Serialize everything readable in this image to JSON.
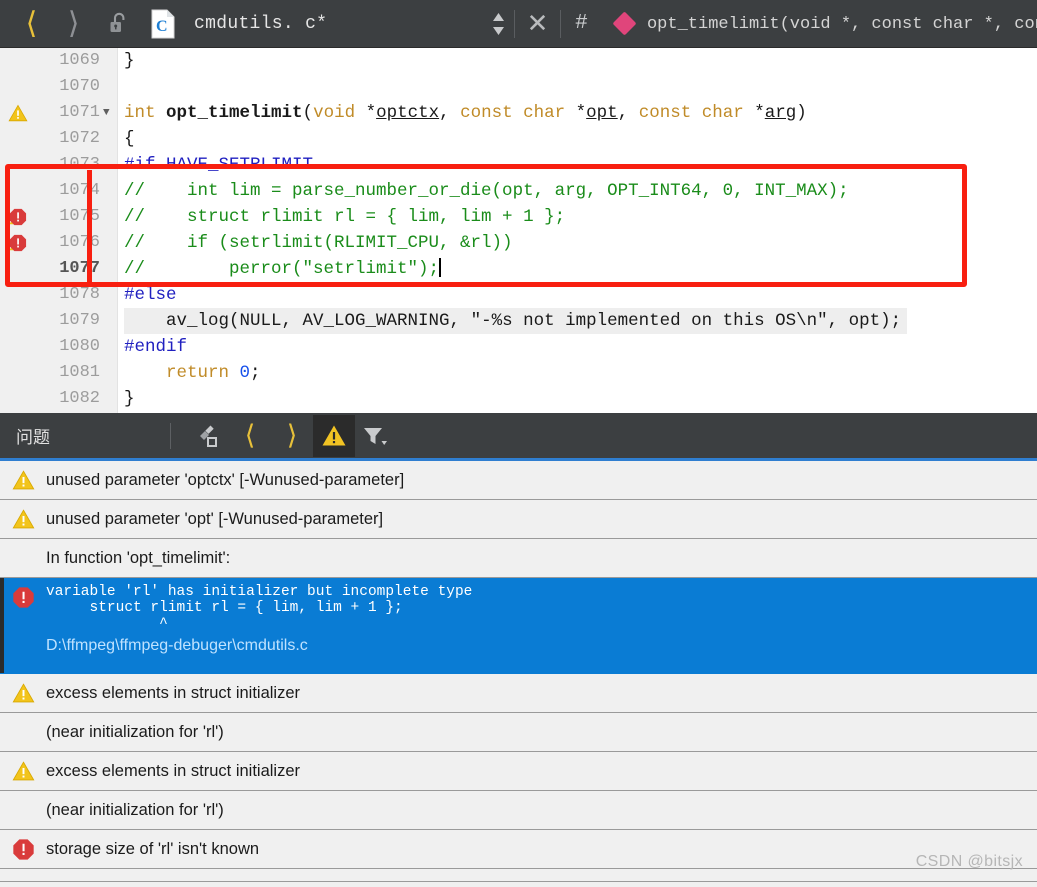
{
  "toolbar": {
    "back_icon": "chevron-left-icon",
    "forward_icon": "chevron-right-icon",
    "lock_icon": "unlock-icon",
    "file_type_icon": "c-file-icon",
    "file_type_letter": "C",
    "file_title": "cmdutils. c*",
    "updown_icon": "sort-updown-icon",
    "close_icon": "close-x-icon",
    "hash_label": "#",
    "member_icon": "pink-diamond-method-icon",
    "breadcrumb_signature": "opt_timelimit(void *, const char *, cons⋯"
  },
  "editor": {
    "first_line": 1069,
    "current_line": 1077,
    "lines": [
      {
        "num": "1069",
        "marker": "",
        "fold": false,
        "highlight": false,
        "tokens": [
          {
            "t": "}",
            "c": "s-plain"
          }
        ]
      },
      {
        "num": "1070",
        "marker": "",
        "fold": false,
        "highlight": false,
        "tokens": []
      },
      {
        "num": "1071",
        "marker": "warning",
        "fold": true,
        "highlight": false,
        "tokens": [
          {
            "t": "int ",
            "c": "s-kw"
          },
          {
            "t": "opt_timelimit",
            "c": "s-fn"
          },
          {
            "t": "(",
            "c": "s-plain"
          },
          {
            "t": "void ",
            "c": "s-kw"
          },
          {
            "t": "*",
            "c": "s-plain"
          },
          {
            "t": "optctx",
            "c": "s-param"
          },
          {
            "t": ", ",
            "c": "s-plain"
          },
          {
            "t": "const char ",
            "c": "s-kw"
          },
          {
            "t": "*",
            "c": "s-plain"
          },
          {
            "t": "opt",
            "c": "s-param"
          },
          {
            "t": ", ",
            "c": "s-plain"
          },
          {
            "t": "const char ",
            "c": "s-kw"
          },
          {
            "t": "*",
            "c": "s-plain"
          },
          {
            "t": "arg",
            "c": "s-param"
          },
          {
            "t": ")",
            "c": "s-plain"
          }
        ]
      },
      {
        "num": "1072",
        "marker": "",
        "fold": false,
        "highlight": false,
        "tokens": [
          {
            "t": "{",
            "c": "s-plain"
          }
        ]
      },
      {
        "num": "1073",
        "marker": "",
        "fold": false,
        "highlight": false,
        "tokens": [
          {
            "t": "#if HAVE_SETRLIMIT",
            "c": "s-pp"
          }
        ]
      },
      {
        "num": "1074",
        "marker": "",
        "fold": false,
        "highlight": false,
        "tokens": [
          {
            "t": "//    int lim = parse_number_or_die(opt, arg, OPT_INT64, 0, INT_MAX);",
            "c": "s-comment"
          }
        ]
      },
      {
        "num": "1075",
        "marker": "error",
        "fold": false,
        "highlight": false,
        "tokens": [
          {
            "t": "//    struct rlimit rl = { lim, lim + 1 };",
            "c": "s-comment"
          }
        ]
      },
      {
        "num": "1076",
        "marker": "error",
        "fold": false,
        "highlight": false,
        "tokens": [
          {
            "t": "//    if (setrlimit(RLIMIT_CPU, &rl))",
            "c": "s-comment"
          }
        ]
      },
      {
        "num": "1077",
        "marker": "",
        "fold": false,
        "highlight": false,
        "current": true,
        "caret": true,
        "tokens": [
          {
            "t": "//        perror(\"setrlimit\");",
            "c": "s-comment"
          }
        ]
      },
      {
        "num": "1078",
        "marker": "",
        "fold": false,
        "highlight": false,
        "tokens": [
          {
            "t": "#else",
            "c": "s-pp"
          }
        ]
      },
      {
        "num": "1079",
        "marker": "",
        "fold": false,
        "highlight": true,
        "tokens": [
          {
            "t": "    av_log(NULL, AV_LOG_WARNING, ",
            "c": "s-plain"
          },
          {
            "t": "\"-%s not implemented on this OS\\n\"",
            "c": "s-plain"
          },
          {
            "t": ", opt);",
            "c": "s-plain"
          }
        ]
      },
      {
        "num": "1080",
        "marker": "",
        "fold": false,
        "highlight": false,
        "tokens": [
          {
            "t": "#endif",
            "c": "s-pp"
          }
        ]
      },
      {
        "num": "1081",
        "marker": "",
        "fold": false,
        "highlight": false,
        "tokens": [
          {
            "t": "    ",
            "c": "s-plain"
          },
          {
            "t": "return ",
            "c": "s-kw"
          },
          {
            "t": "0",
            "c": "s-num"
          },
          {
            "t": ";",
            "c": "s-plain"
          }
        ]
      },
      {
        "num": "1082",
        "marker": "",
        "fold": false,
        "highlight": false,
        "tokens": [
          {
            "t": "}",
            "c": "s-plain"
          }
        ]
      }
    ],
    "annotation": {
      "shape": "rectangle",
      "color": "#f81f10",
      "covers_lines": "1074-1077"
    }
  },
  "problems_panel": {
    "title": "问题",
    "toolbar": [
      {
        "name": "clear-all-icon",
        "label": ""
      },
      {
        "name": "previous-problem-icon",
        "label": "‹"
      },
      {
        "name": "next-problem-icon",
        "label": "›"
      },
      {
        "name": "warnings-filter-icon",
        "label": "",
        "active": true
      },
      {
        "name": "filter-dropdown-icon",
        "label": ""
      }
    ],
    "rows": [
      {
        "severity": "warning",
        "text": "unused parameter 'optctx' [-Wunused-parameter]",
        "type": "simple"
      },
      {
        "severity": "warning",
        "text": "unused parameter 'opt' [-Wunused-parameter]",
        "type": "simple"
      },
      {
        "severity": "none",
        "text": "In function 'opt_timelimit':",
        "type": "simple"
      },
      {
        "severity": "error",
        "type": "selected",
        "text": "variable 'rl' has initializer but incomplete type",
        "code": "     struct rlimit rl = { lim, lim + 1 };",
        "caret": "             ^",
        "path": "D:\\ffmpeg\\ffmpeg-debuger\\cmdutils.c"
      },
      {
        "severity": "warning",
        "text": "excess elements in struct initializer",
        "type": "simple"
      },
      {
        "severity": "none",
        "text": "(near initialization for 'rl')",
        "type": "simple"
      },
      {
        "severity": "warning",
        "text": "excess elements in struct initializer",
        "type": "simple"
      },
      {
        "severity": "none",
        "text": "(near initialization for 'rl')",
        "type": "simple"
      },
      {
        "severity": "error",
        "text": "storage size of 'rl' isn't known",
        "type": "simple"
      }
    ]
  },
  "watermark": "CSDN @bitsjx",
  "colors": {
    "chrome": "#3c3f41",
    "accent_yellow": "#e8c13a",
    "selection_blue": "#0a7cd4",
    "annotation_red": "#f81f10",
    "warning_yellow": "#f0c419",
    "error_red": "#d93b3b",
    "diamond_pink": "#e0457b"
  }
}
